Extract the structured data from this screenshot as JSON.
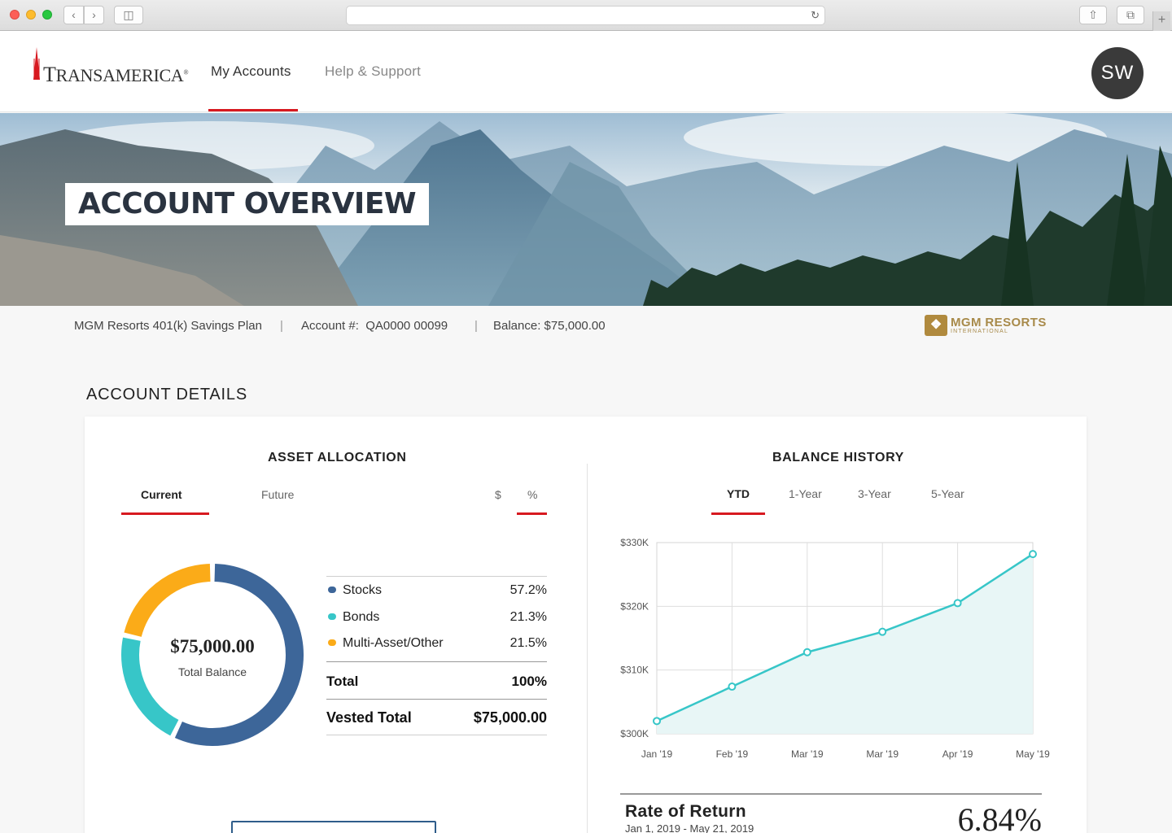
{
  "browser": {
    "nav_back_icon": "chevron-left-icon",
    "nav_forward_icon": "chevron-right-icon",
    "sidebar_icon": "sidebar-icon",
    "reload_icon": "reload-icon",
    "share_icon": "share-icon",
    "tabs_icon": "tabs-icon",
    "new_tab_icon": "plus-icon"
  },
  "header": {
    "brand": "Transamerica",
    "nav": [
      "My Accounts",
      "Help & Support"
    ],
    "avatar_initials": "SW",
    "accent_color": "#d71920"
  },
  "hero": {
    "title": "ACCOUNT OVERVIEW"
  },
  "account": {
    "plan": "MGM Resorts 401(k) Savings Plan",
    "number": "Account #:  QA0000 00099",
    "balance": "Balance: $75,000.00",
    "sponsor_logo": "MGM RESORTS",
    "sponsor_logo_sub": "INTERNATIONAL"
  },
  "section_title": "ACCOUNT DETAILS",
  "asset_allocation": {
    "title": "ASSET ALLOCATION",
    "tabs": [
      "Current",
      "Future"
    ],
    "units": [
      "$",
      "%"
    ],
    "total_balance": "$75,000.00",
    "total_balance_label": "Total Balance",
    "rows": [
      {
        "name": "Stocks",
        "pct": "57.2%",
        "color": "#3d6699"
      },
      {
        "name": "Bonds",
        "pct": "21.3%",
        "color": "#37c6c8"
      },
      {
        "name": "Multi-Asset/Other",
        "pct": "21.5%",
        "color": "#fbab18"
      }
    ],
    "total_label": "Total",
    "total_value": "100%",
    "vested_label": "Vested Total",
    "vested_value": "$75,000.00"
  },
  "balance_history": {
    "title": "BALANCE HISTORY",
    "tabs": [
      "YTD",
      "1-Year",
      "3-Year",
      "5-Year"
    ],
    "rate_title": "Rate of Return",
    "rate_dates": "Jan 1, 2019 - May 21, 2019",
    "rate_value": "6.84%"
  },
  "chart_data": {
    "type": "area",
    "x": [
      "Jan '19",
      "Feb '19",
      "Mar '19",
      "Mar '19",
      "Apr '19",
      "May '19"
    ],
    "series": [
      {
        "values": [
          302000,
          307400,
          312800,
          316000,
          320500,
          328200
        ]
      }
    ],
    "y_ticks": [
      "$300K",
      "$310K",
      "$320K",
      "$330K"
    ],
    "ylim": [
      300000,
      330000
    ],
    "grid": true,
    "line_color": "#37c6c8",
    "fill_color": "#e8f6f6"
  }
}
